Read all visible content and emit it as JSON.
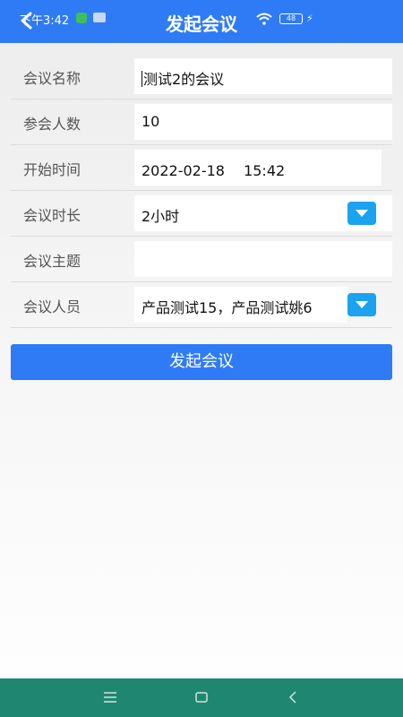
{
  "status_bar": {
    "time": "下午3:42",
    "battery": "48"
  },
  "header": {
    "title": "发起会议"
  },
  "form": {
    "rows": [
      {
        "label": "会议名称",
        "value": "测试2的会议"
      },
      {
        "label": "参会人数",
        "value": "10"
      },
      {
        "label": "开始时间",
        "value": "2022-02-18　 15:42"
      },
      {
        "label": "会议时长",
        "value": "2小时"
      },
      {
        "label": "会议主题",
        "value": ""
      },
      {
        "label": "会议人员",
        "value": "产品测试15，产品测试姚6"
      }
    ]
  },
  "submit": {
    "label": "发起会议"
  },
  "colors": {
    "accent": "#2f7bf5",
    "dropdown": "#1aa3ee",
    "navbar": "#1f8771"
  },
  "icons": [
    "back-icon",
    "wifi-icon",
    "battery-icon",
    "chevron-down-icon",
    "menu-icon",
    "home-icon",
    "back-nav-icon"
  ]
}
